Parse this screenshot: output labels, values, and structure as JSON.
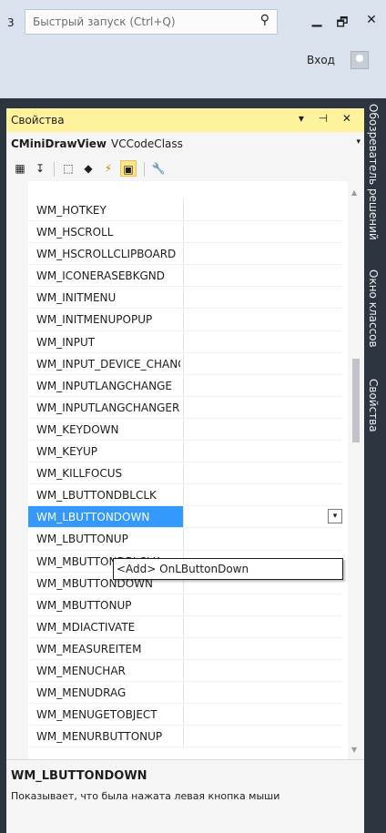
{
  "titlebar": {
    "number": "3",
    "quick_launch_placeholder": "Быстрый запуск (Ctrl+Q)",
    "search_icon": "⚲",
    "minimize_icon": "▁",
    "maximize_icon": "🗗",
    "close_icon": "✕",
    "signin_label": "Вход"
  },
  "panel": {
    "title": "Свойства",
    "controls": "▾ ⊣ ✕",
    "object_name": "CMiniDrawView",
    "object_type": "VCCodeClass",
    "dropdown_icon": "▾",
    "toolbar": {
      "categorized": "▦",
      "alphabetical": "↧",
      "properties": "⬚",
      "events": "◆",
      "messages": "⚡",
      "overrides": "▣",
      "property_pages": "🔧"
    },
    "rows": [
      "WM_HOTKEY",
      "WM_HSCROLL",
      "WM_HSCROLLCLIPBOARD",
      "WM_ICONERASEBKGND",
      "WM_INITMENU",
      "WM_INITMENUPOPUP",
      "WM_INPUT",
      "WM_INPUT_DEVICE_CHANGE",
      "WM_INPUTLANGCHANGE",
      "WM_INPUTLANGCHANGEREQUEST",
      "WM_KEYDOWN",
      "WM_KEYUP",
      "WM_KILLFOCUS",
      "WM_LBUTTONDBLCLK",
      "WM_LBUTTONDOWN",
      "WM_LBUTTONUP",
      "WM_MBUTTONDBLCLK",
      "WM_MBUTTONDOWN",
      "WM_MBUTTONUP",
      "WM_MDIACTIVATE",
      "WM_MEASUREITEM",
      "WM_MENUCHAR",
      "WM_MENUDRAG",
      "WM_MENUGETOBJECT",
      "WM_MENURBUTTONUP"
    ],
    "popup_item": "<Add> OnLButtonDown",
    "description_title": "WM_LBUTTONDOWN",
    "description_text": "Показывает, что была нажата левая кнопка мыши"
  },
  "side_tabs": [
    "Обозреватель решений",
    "Окно классов",
    "Свойства"
  ]
}
